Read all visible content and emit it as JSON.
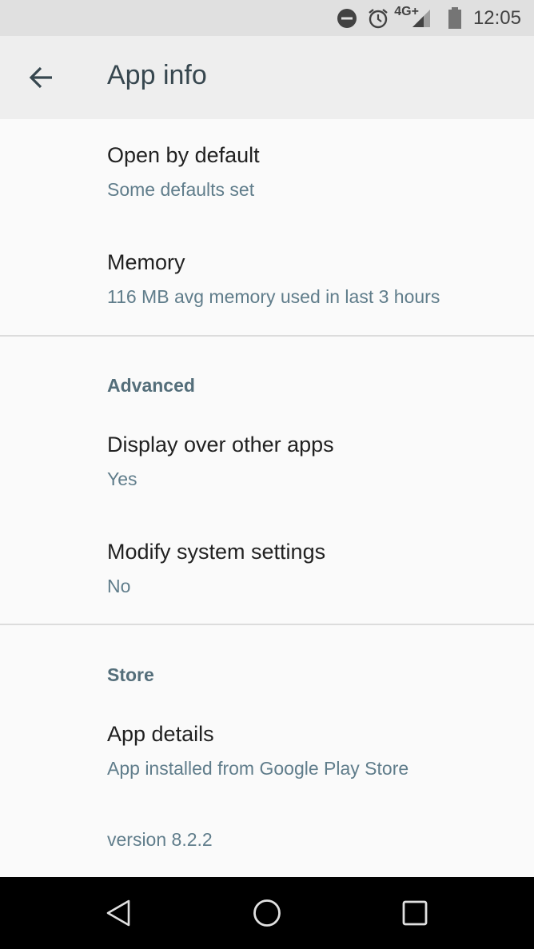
{
  "status_bar": {
    "network_label": "4G+",
    "time": "12:05",
    "icons": [
      "do-not-disturb-icon",
      "alarm-icon",
      "signal-icon",
      "battery-icon"
    ]
  },
  "app_bar": {
    "title": "App info",
    "back_icon": "arrow-back-icon"
  },
  "items": [
    {
      "title": "Open by default",
      "summary": "Some defaults set"
    },
    {
      "title": "Memory",
      "summary": "116 MB avg memory used in last 3 hours"
    }
  ],
  "sections": {
    "advanced": {
      "header": "Advanced",
      "items": [
        {
          "title": "Display over other apps",
          "summary": "Yes"
        },
        {
          "title": "Modify system settings",
          "summary": "No"
        }
      ]
    },
    "store": {
      "header": "Store",
      "items": [
        {
          "title": "App details",
          "summary": "App installed from Google Play Store"
        }
      ]
    }
  },
  "version_text": "version 8.2.2",
  "nav_bar": {
    "icons": [
      "back-triangle-icon",
      "home-circle-icon",
      "recents-square-icon"
    ]
  },
  "colors": {
    "status_bar_bg": "#e0e0e0",
    "app_bar_bg": "#eeeeee",
    "title_text": "#37474f",
    "primary_text": "#212121",
    "secondary_text": "#607d8b",
    "section_header": "#546e7a",
    "nav_bar_bg": "#000000"
  }
}
